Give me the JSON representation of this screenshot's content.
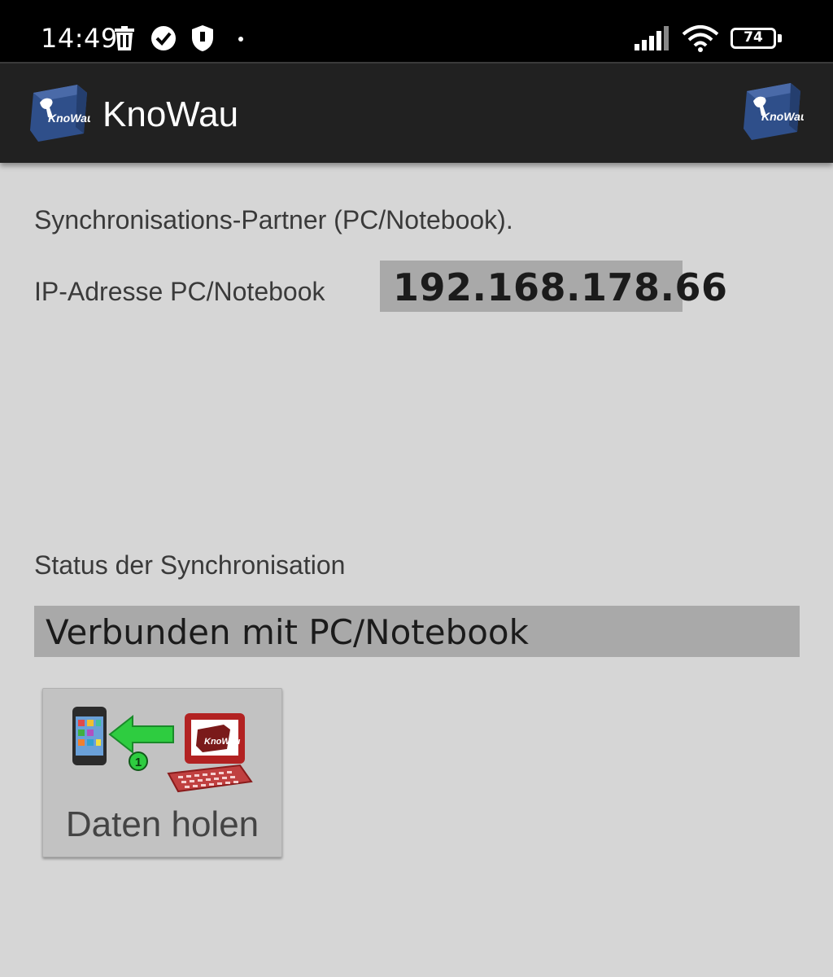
{
  "status_bar": {
    "time": "14:49",
    "icons": [
      "trash-icon",
      "check-circle-icon",
      "shield-icon",
      "dot-icon",
      "signal-icon",
      "wifi-icon"
    ],
    "battery_level": "74"
  },
  "app_bar": {
    "title": "KnoWau",
    "logo_text": "KnoWau"
  },
  "content": {
    "partner_heading": "Synchronisations-Partner (PC/Notebook).",
    "ip_label": "IP-Adresse PC/Notebook",
    "ip_value": "192.168.178.66",
    "status_label": "Status der Synchronisation",
    "status_value": "Verbunden mit PC/Notebook"
  },
  "actions": {
    "fetch_data_label": "Daten holen",
    "fetch_badge": "1"
  },
  "colors": {
    "status_bar_bg": "#000000",
    "app_bar_bg": "#212121",
    "page_bg": "#d6d6d6",
    "value_box_bg": "#a9a9a9",
    "button_bg": "#c2c2c2",
    "arrow_green": "#2ecc40",
    "pc_red": "#b22222"
  }
}
